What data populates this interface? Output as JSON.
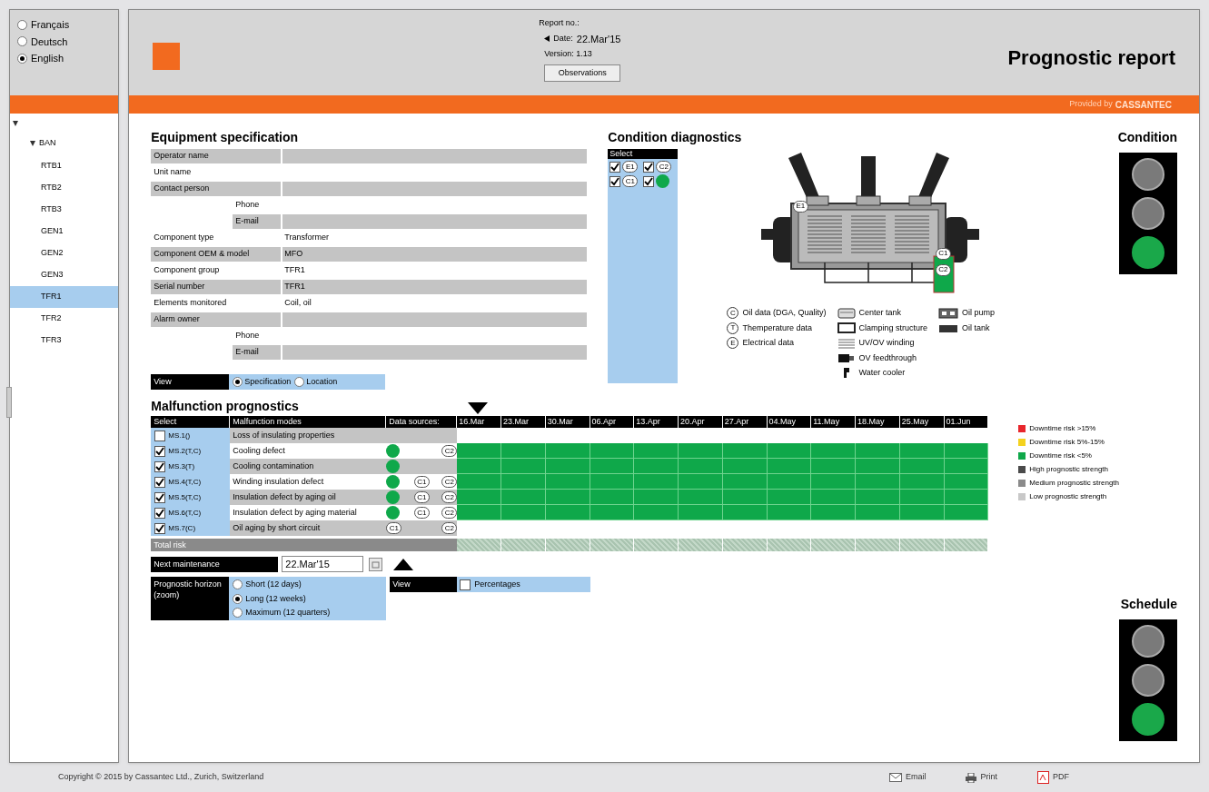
{
  "languages": [
    {
      "label": "Français",
      "selected": false
    },
    {
      "label": "Deutsch",
      "selected": false
    },
    {
      "label": "English",
      "selected": true
    }
  ],
  "tree": {
    "expanded": true,
    "children": [
      {
        "label": "BAN",
        "expanded": true,
        "children": [
          {
            "label": "RTB1",
            "selected": false
          },
          {
            "label": "RTB2",
            "selected": false
          },
          {
            "label": "RTB3",
            "selected": false
          },
          {
            "label": "GEN1",
            "selected": false
          },
          {
            "label": "GEN2",
            "selected": false
          },
          {
            "label": "GEN3",
            "selected": false
          },
          {
            "label": "TFR1",
            "selected": true
          },
          {
            "label": "TFR2",
            "selected": false
          },
          {
            "label": "TFR3",
            "selected": false
          }
        ]
      }
    ]
  },
  "header": {
    "report_no": "Report no.:",
    "date_label": "Date:",
    "date": "22.Mar'15",
    "version": "Version: 1.13",
    "observations_button": "Observations",
    "title": "Prognostic report",
    "provided_by": "Provided by",
    "brand": "CASSANTEC"
  },
  "equipment": {
    "title": "Equipment specification",
    "rows": [
      {
        "kind": "main",
        "label": "Operator name"
      },
      {
        "kind": "main",
        "label": "Unit name"
      },
      {
        "kind": "main",
        "label": "Contact person"
      },
      {
        "kind": "sub",
        "label": "Phone"
      },
      {
        "kind": "sub",
        "label": "E-mail"
      },
      {
        "kind": "main",
        "label": "Component type",
        "value": "Transformer"
      },
      {
        "kind": "main",
        "label": "Component OEM & model",
        "value": "MFO"
      },
      {
        "kind": "main",
        "label": "Component group",
        "value": "TFR1"
      },
      {
        "kind": "main",
        "label": "Serial number",
        "value": "TFR1"
      },
      {
        "kind": "main",
        "label": "Elements monitored",
        "value": "Coil, oil"
      },
      {
        "kind": "main",
        "label": "Alarm owner"
      },
      {
        "kind": "sub",
        "label": "Phone"
      },
      {
        "kind": "sub",
        "label": "E-mail"
      }
    ],
    "view": {
      "label": "View",
      "options": [
        {
          "label": "Specification",
          "selected": true
        },
        {
          "label": "Location",
          "selected": false
        }
      ]
    }
  },
  "diagnostics": {
    "title": "Condition diagnostics",
    "select_label": "Select",
    "items": [
      {
        "kind": "label",
        "text": "E1",
        "checked": true
      },
      {
        "kind": "label",
        "text": "C2",
        "checked": true
      },
      {
        "kind": "label",
        "text": "C1",
        "checked": true
      },
      {
        "kind": "dot",
        "checked": true
      }
    ],
    "diagram_labels": [
      "E1",
      "C1",
      "C2"
    ],
    "legend": [
      {
        "kind": "letter",
        "symbol": "C",
        "text": "Oil data (DGA, Quality)"
      },
      {
        "kind": "letter",
        "symbol": "T",
        "text": "Themperature data"
      },
      {
        "kind": "letter",
        "symbol": "E",
        "text": "Electrical data"
      },
      {
        "kind": "center-tank",
        "text": "Center tank"
      },
      {
        "kind": "clamping",
        "text": "Clamping structure"
      },
      {
        "kind": "winding",
        "text": "UV/OV winding"
      },
      {
        "kind": "feedthrough",
        "text": "OV feedthrough"
      },
      {
        "kind": "cooler",
        "text": "Water cooler"
      },
      {
        "kind": "pump",
        "text": "Oil pump"
      },
      {
        "kind": "oil-tank",
        "text": "Oil tank"
      }
    ]
  },
  "condition": {
    "title": "Condition",
    "lights": [
      {
        "on": false
      },
      {
        "on": false
      },
      {
        "on": true,
        "color": "#1aa84a"
      }
    ]
  },
  "malfunction": {
    "title": "Malfunction prognostics",
    "columns": [
      "Select",
      "Malfunction modes",
      "Data sources:"
    ],
    "dates": [
      "16.Mar",
      "23.Mar",
      "30.Mar",
      "06.Apr",
      "13.Apr",
      "20.Apr",
      "27.Apr",
      "04.May",
      "11.May",
      "18.May",
      "25.May",
      "01.Jun"
    ],
    "rows": [
      {
        "code": "MS.1()",
        "checked": false,
        "mode": "Loss of insulating properties",
        "sources": [
          {
            "kind": "blank"
          },
          {
            "kind": "blank"
          },
          {
            "kind": "blank"
          }
        ]
      },
      {
        "code": "MS.2(T,C)",
        "checked": true,
        "mode": "Cooling defect",
        "sources": [
          {
            "kind": "dot"
          },
          {
            "kind": "blank"
          },
          {
            "kind": "label",
            "text": "C2"
          }
        ],
        "color": "#0fa84a"
      },
      {
        "code": "MS.3(T)",
        "checked": true,
        "mode": "Cooling contamination",
        "sources": [
          {
            "kind": "dot"
          },
          {
            "kind": "blank"
          },
          {
            "kind": "blank"
          }
        ],
        "color": "#0fa84a"
      },
      {
        "code": "MS.4(T,C)",
        "checked": true,
        "mode": "Winding insulation defect",
        "sources": [
          {
            "kind": "dot"
          },
          {
            "kind": "label",
            "text": "C1"
          },
          {
            "kind": "label",
            "text": "C2"
          }
        ],
        "color": "#0fa84a"
      },
      {
        "code": "MS.5(T,C)",
        "checked": true,
        "mode": "Insulation defect by aging oil",
        "sources": [
          {
            "kind": "dot"
          },
          {
            "kind": "label",
            "text": "C1"
          },
          {
            "kind": "label",
            "text": "C2"
          }
        ],
        "color": "#0fa84a"
      },
      {
        "code": "MS.6(T,C)",
        "checked": true,
        "mode": "Insulation defect by aging material",
        "sources": [
          {
            "kind": "dot"
          },
          {
            "kind": "label",
            "text": "C1"
          },
          {
            "kind": "label",
            "text": "C2"
          }
        ],
        "color": "#0fa84a"
      },
      {
        "code": "MS.7(C)",
        "checked": true,
        "mode": "Oil aging by short circuit",
        "sources": [
          {
            "kind": "label",
            "text": "C1"
          },
          {
            "kind": "blank"
          },
          {
            "kind": "label",
            "text": "C2"
          }
        ]
      }
    ],
    "total_risk": "Total risk",
    "next_maintenance": {
      "label": "Next maintenance",
      "value": "22.Mar'15"
    },
    "horizon": {
      "label": "Prognostic horizon (zoom)",
      "options": [
        {
          "label": "Short (12 days)",
          "selected": false
        },
        {
          "label": "Long (12 weeks)",
          "selected": true
        },
        {
          "label": "Maximum (12 quarters)",
          "selected": false
        }
      ]
    },
    "view": {
      "label": "View",
      "option": {
        "label": "Percentages",
        "checked": false
      }
    }
  },
  "legend": [
    {
      "text": "Downtime risk >15%",
      "color": "#e8262c"
    },
    {
      "text": "Downtime risk 5%-15%",
      "color": "#f4d21f"
    },
    {
      "text": "Downtime risk <5%",
      "color": "#0fa84a"
    },
    {
      "text": "High prognostic strength",
      "color": "#4a4a4a"
    },
    {
      "text": "Medium prognostic strength",
      "color": "#8a8a8a"
    },
    {
      "text": "Low prognostic strength",
      "color": "#c8c8c8"
    }
  ],
  "schedule": {
    "title": "Schedule",
    "lights": [
      {
        "on": false
      },
      {
        "on": false
      },
      {
        "on": true,
        "color": "#1aa84a"
      }
    ]
  },
  "footer": {
    "copyright": "Copyright © 2015 by Cassantec Ltd., Zurich, Switzerland",
    "actions": [
      {
        "kind": "email",
        "label": "Email"
      },
      {
        "kind": "print",
        "label": "Print"
      },
      {
        "kind": "pdf",
        "label": "PDF"
      }
    ]
  }
}
